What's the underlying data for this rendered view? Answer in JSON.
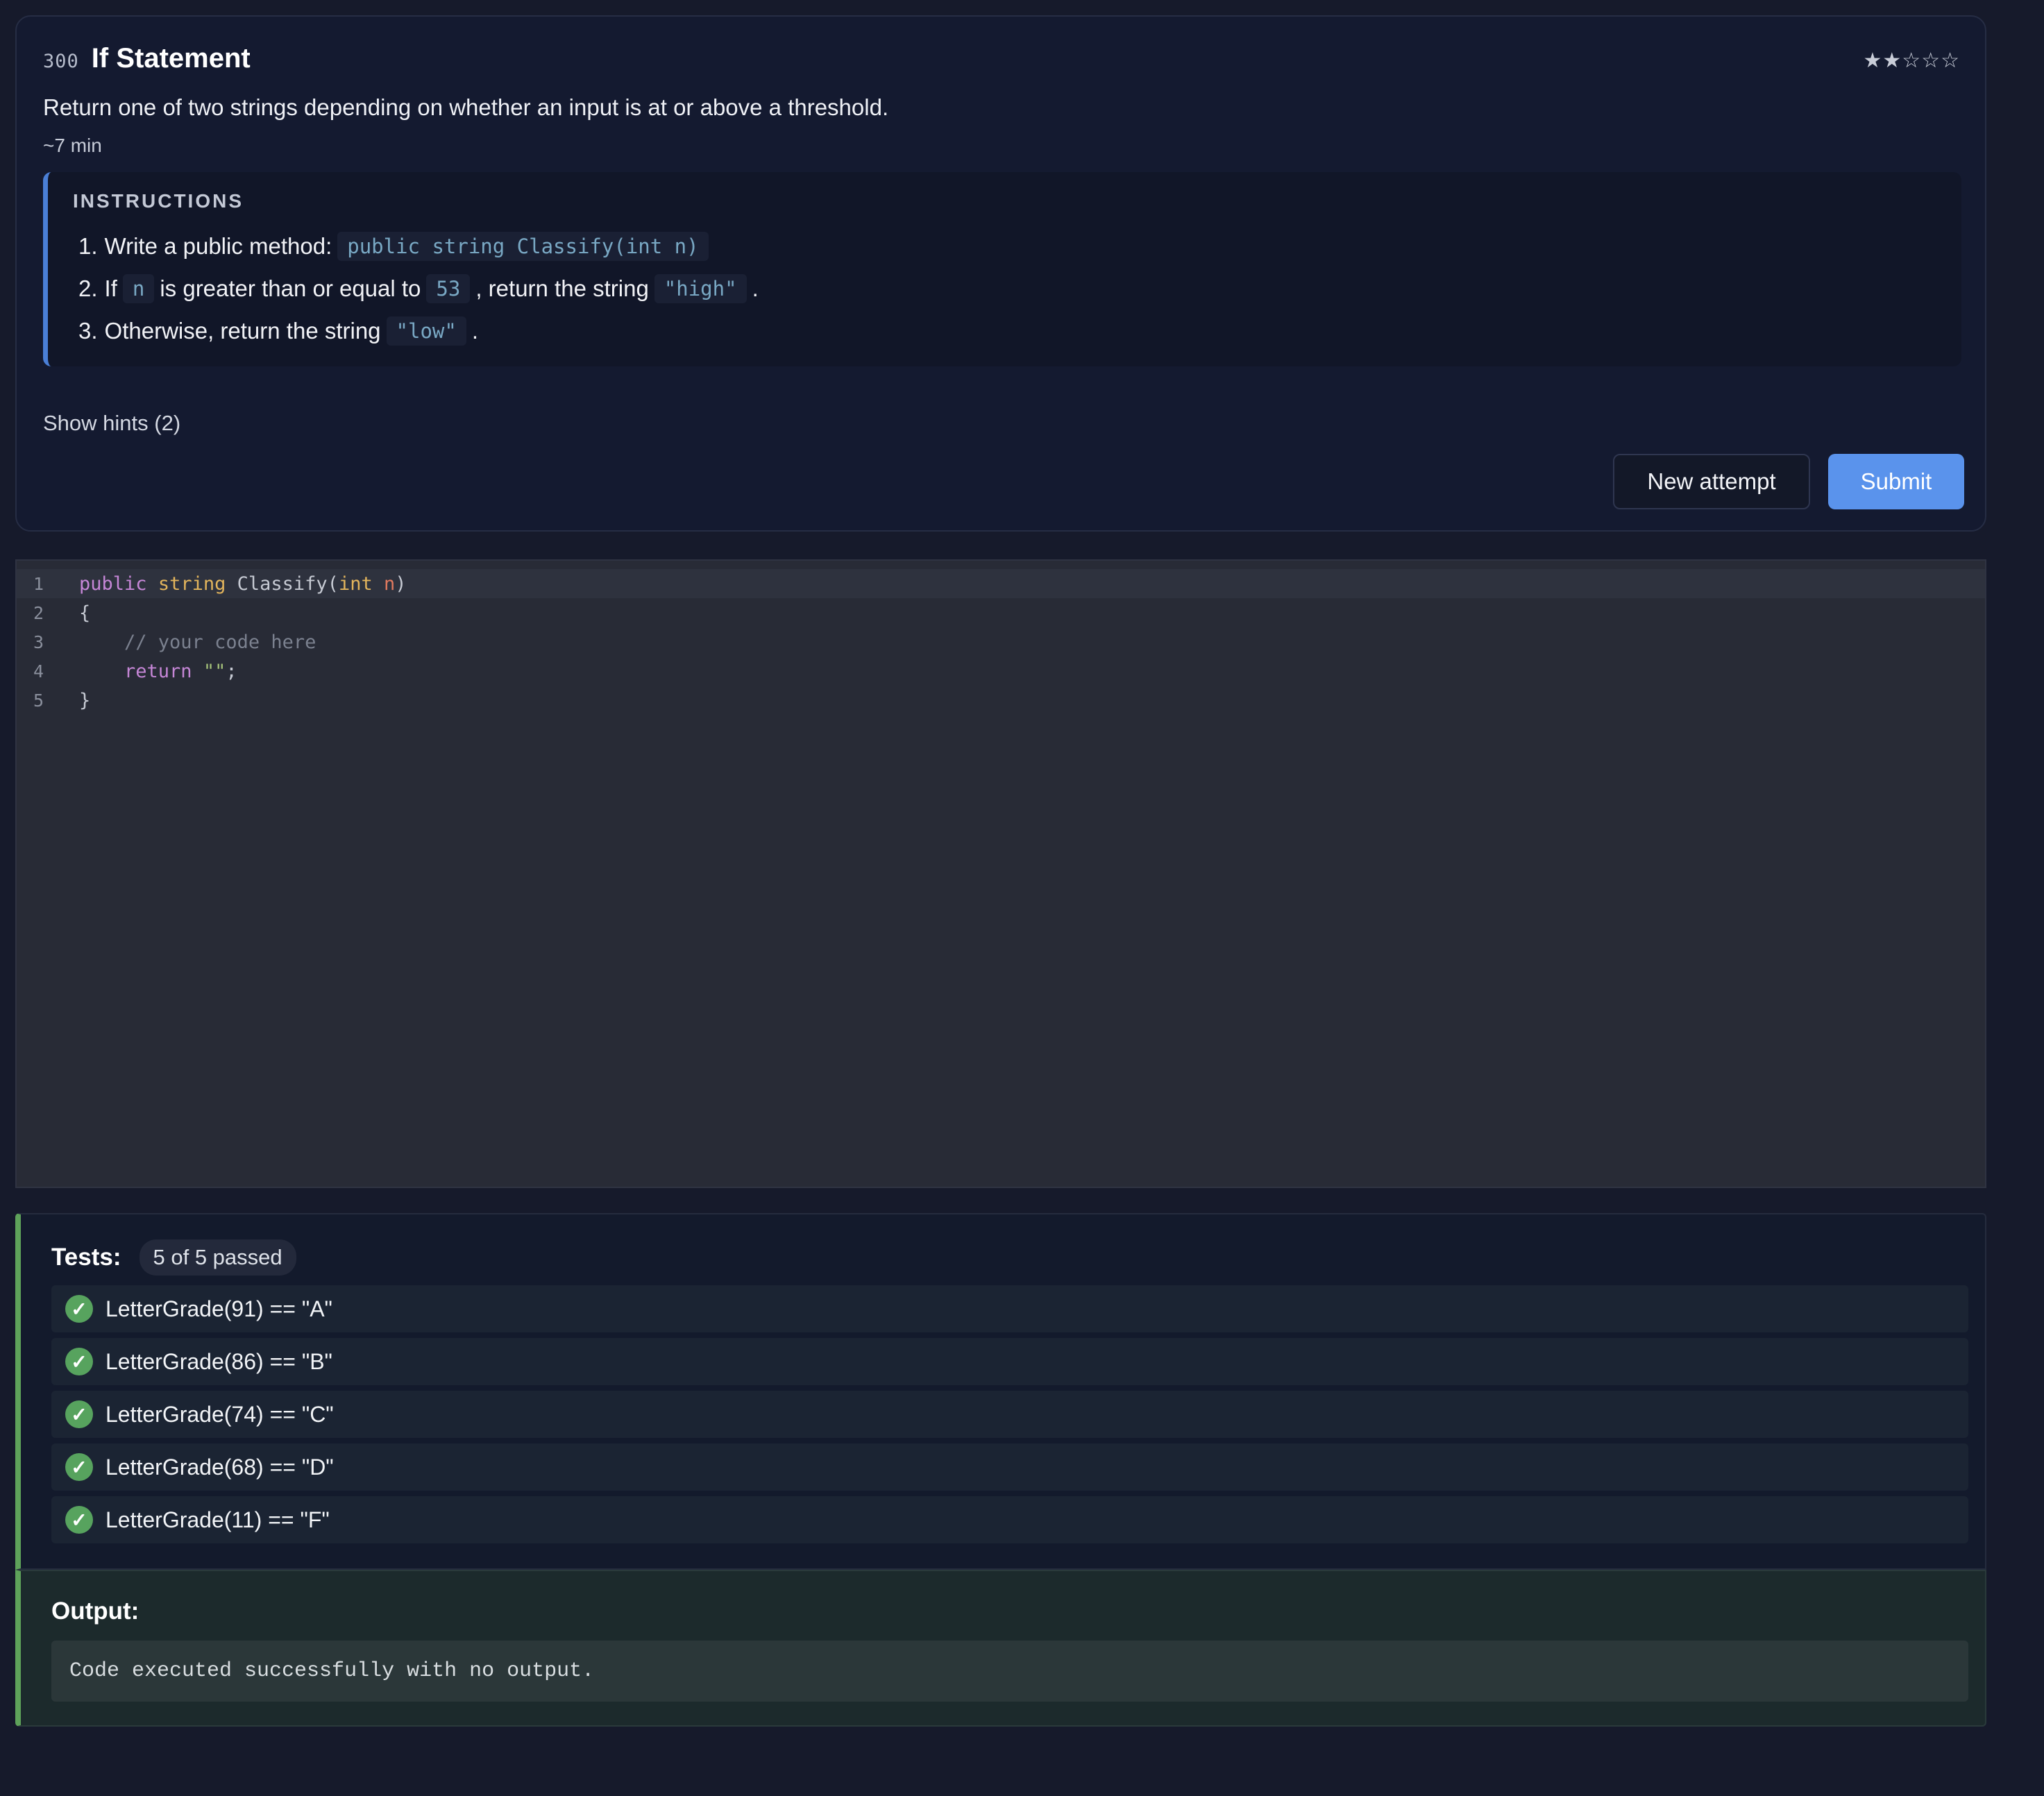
{
  "exercise": {
    "number": "300",
    "title": "If Statement",
    "rating": "★★☆☆☆",
    "description": "Return one of two strings depending on whether an input is at or above a threshold.",
    "duration": "~7 min"
  },
  "instructions": {
    "heading": "INSTRUCTIONS",
    "items": [
      {
        "num": "1.",
        "text_a": "Write a public method:",
        "code_a": "public string Classify(int n)"
      },
      {
        "num": "2.",
        "text_a": "If",
        "code_a": "n",
        "text_b": "is greater than or equal to",
        "code_b": "53",
        "text_c": ", return the string",
        "code_c": "\"high\"",
        "text_d": "."
      },
      {
        "num": "3.",
        "text_a": "Otherwise, return the string",
        "code_a": "\"low\"",
        "text_b": "."
      }
    ]
  },
  "hints": {
    "label": "Show hints (2)"
  },
  "actions": {
    "new_attempt": "New attempt",
    "submit": "Submit"
  },
  "editor": {
    "line_numbers": [
      "1",
      "2",
      "3",
      "4",
      "5"
    ],
    "lines": [
      {
        "kw": "public",
        "ty": "string",
        "fn": "Classify(",
        "ty2": "int",
        "pa": "n",
        "end": ")"
      },
      {
        "text": "{"
      },
      {
        "comment": "    // your code here"
      },
      {
        "indent": "    ",
        "kw": "return",
        "str": "\"\"",
        "end": ";"
      },
      {
        "text": "}"
      }
    ]
  },
  "tests": {
    "label": "Tests:",
    "summary": "5 of 5 passed",
    "check_glyph": "✓",
    "items": [
      "LetterGrade(91) == \"A\"",
      "LetterGrade(86) == \"B\"",
      "LetterGrade(74) == \"C\"",
      "LetterGrade(68) == \"D\"",
      "LetterGrade(11) == \"F\""
    ],
    "status_color": "#57a35e"
  },
  "output": {
    "label": "Output:",
    "text": "Code executed successfully with no output."
  },
  "colors": {
    "background": "#161a2b",
    "accent": "#5a93ec",
    "success": "#5ea25a"
  }
}
